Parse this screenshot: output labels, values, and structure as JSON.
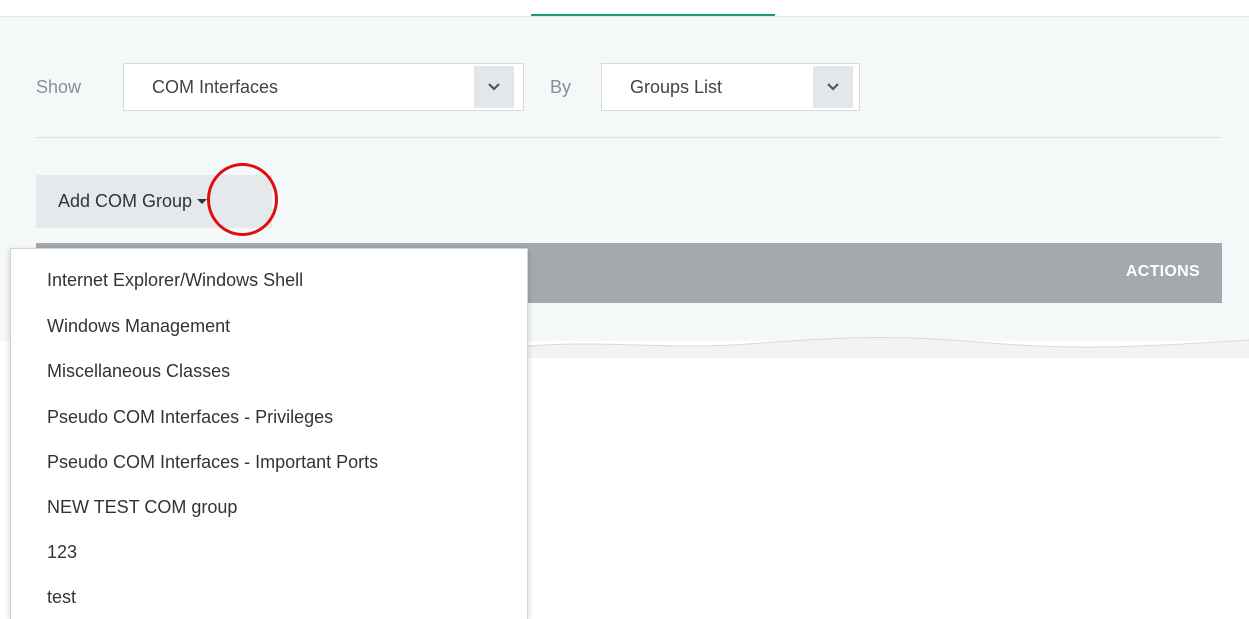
{
  "filter_bar": {
    "show_label": "Show",
    "show_select_value": "COM Interfaces",
    "by_label": "By",
    "by_select_value": "Groups List"
  },
  "add_button": {
    "label": "Add COM Group"
  },
  "table": {
    "actions_header": "ACTIONS"
  },
  "dropdown_menu": {
    "items": [
      "Internet Explorer/Windows Shell",
      "Windows Management",
      "Miscellaneous Classes",
      "Pseudo COM Interfaces - Privileges",
      "Pseudo COM Interfaces - Important Ports",
      "NEW TEST COM group",
      "123",
      "test"
    ]
  },
  "icons": {
    "show_select_caret": "chevron-down-icon",
    "by_select_caret": "chevron-down-icon",
    "add_button_caret": "caret-down-icon"
  },
  "colors": {
    "accent_tab": "#1a9a77",
    "highlight_circle": "#e00d0d",
    "table_header_bg": "#a4a9ae"
  }
}
